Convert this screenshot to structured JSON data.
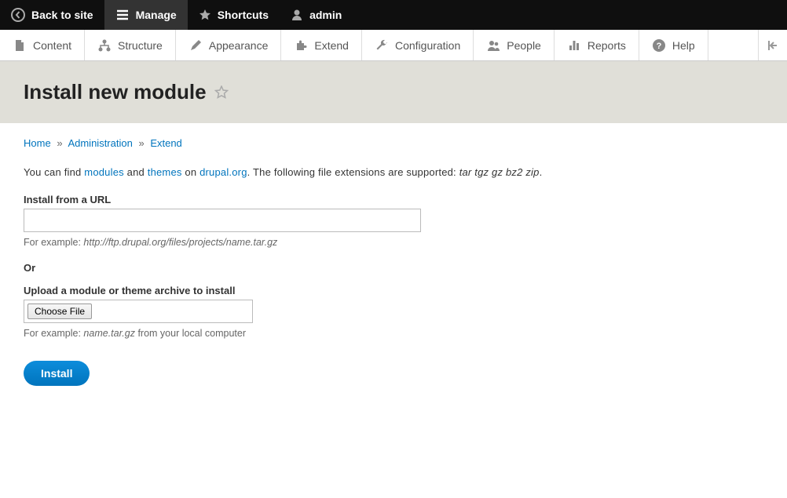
{
  "toolbar": {
    "back": "Back to site",
    "manage": "Manage",
    "shortcuts": "Shortcuts",
    "user": "admin"
  },
  "adminMenu": {
    "content": "Content",
    "structure": "Structure",
    "appearance": "Appearance",
    "extend": "Extend",
    "configuration": "Configuration",
    "people": "People",
    "reports": "Reports",
    "help": "Help"
  },
  "page": {
    "title": "Install new module"
  },
  "breadcrumb": {
    "home": "Home",
    "administration": "Administration",
    "extend": "Extend"
  },
  "intro": {
    "prefix": "You can find ",
    "link_modules": "modules",
    "mid1": " and ",
    "link_themes": "themes",
    "mid2": " on ",
    "link_drupal": "drupal.org",
    "suffix": ". The following file extensions are supported: ",
    "extensions": "tar tgz gz bz2 zip",
    "period": "."
  },
  "form": {
    "url_label": "Install from a URL",
    "url_help_prefix": "For example: ",
    "url_help_example": "http://ftp.drupal.org/files/projects/name.tar.gz",
    "or": "Or",
    "upload_label": "Upload a module or theme archive to install",
    "choose_file": "Choose File",
    "upload_help_prefix": "For example: ",
    "upload_help_example": "name.tar.gz",
    "upload_help_suffix": " from your local computer",
    "submit": "Install"
  }
}
